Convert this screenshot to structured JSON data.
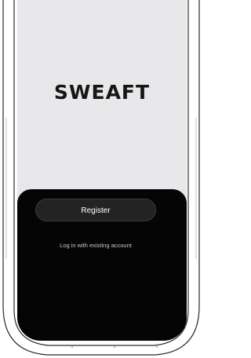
{
  "app": {
    "brand": "SWEAFT"
  },
  "auth": {
    "register_label": "Register",
    "login_label": "Log in with existing account"
  }
}
